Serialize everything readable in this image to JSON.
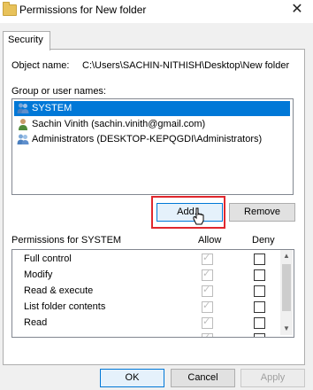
{
  "window": {
    "title": "Permissions for New folder",
    "close_symbol": "✕"
  },
  "tabs": [
    {
      "label": "Security"
    }
  ],
  "object": {
    "label": "Object name:",
    "value": "C:\\Users\\SACHIN-NITHISH\\Desktop\\New folder"
  },
  "group_list": {
    "label": "Group or user names:",
    "items": [
      {
        "label": "SYSTEM",
        "icon": "users-group-icon",
        "selected": true
      },
      {
        "label": "Sachin Vinith (sachin.vinith@gmail.com)",
        "icon": "user-icon",
        "selected": false
      },
      {
        "label": "Administrators (DESKTOP-KEPQGDI\\Administrators)",
        "icon": "users-group-icon",
        "selected": false
      }
    ]
  },
  "buttons": {
    "add": "Add...",
    "remove": "Remove",
    "ok": "OK",
    "cancel": "Cancel",
    "apply": "Apply"
  },
  "permissions": {
    "label": "Permissions for SYSTEM",
    "allow_header": "Allow",
    "deny_header": "Deny",
    "rows": [
      {
        "name": "Full control",
        "allow": true,
        "deny": false
      },
      {
        "name": "Modify",
        "allow": true,
        "deny": false
      },
      {
        "name": "Read & execute",
        "allow": true,
        "deny": false
      },
      {
        "name": "List folder contents",
        "allow": true,
        "deny": false
      },
      {
        "name": "Read",
        "allow": true,
        "deny": false
      }
    ]
  },
  "colors": {
    "selection": "#0078d7",
    "highlight_box": "#e0282e",
    "folder": "#e8c25a"
  }
}
